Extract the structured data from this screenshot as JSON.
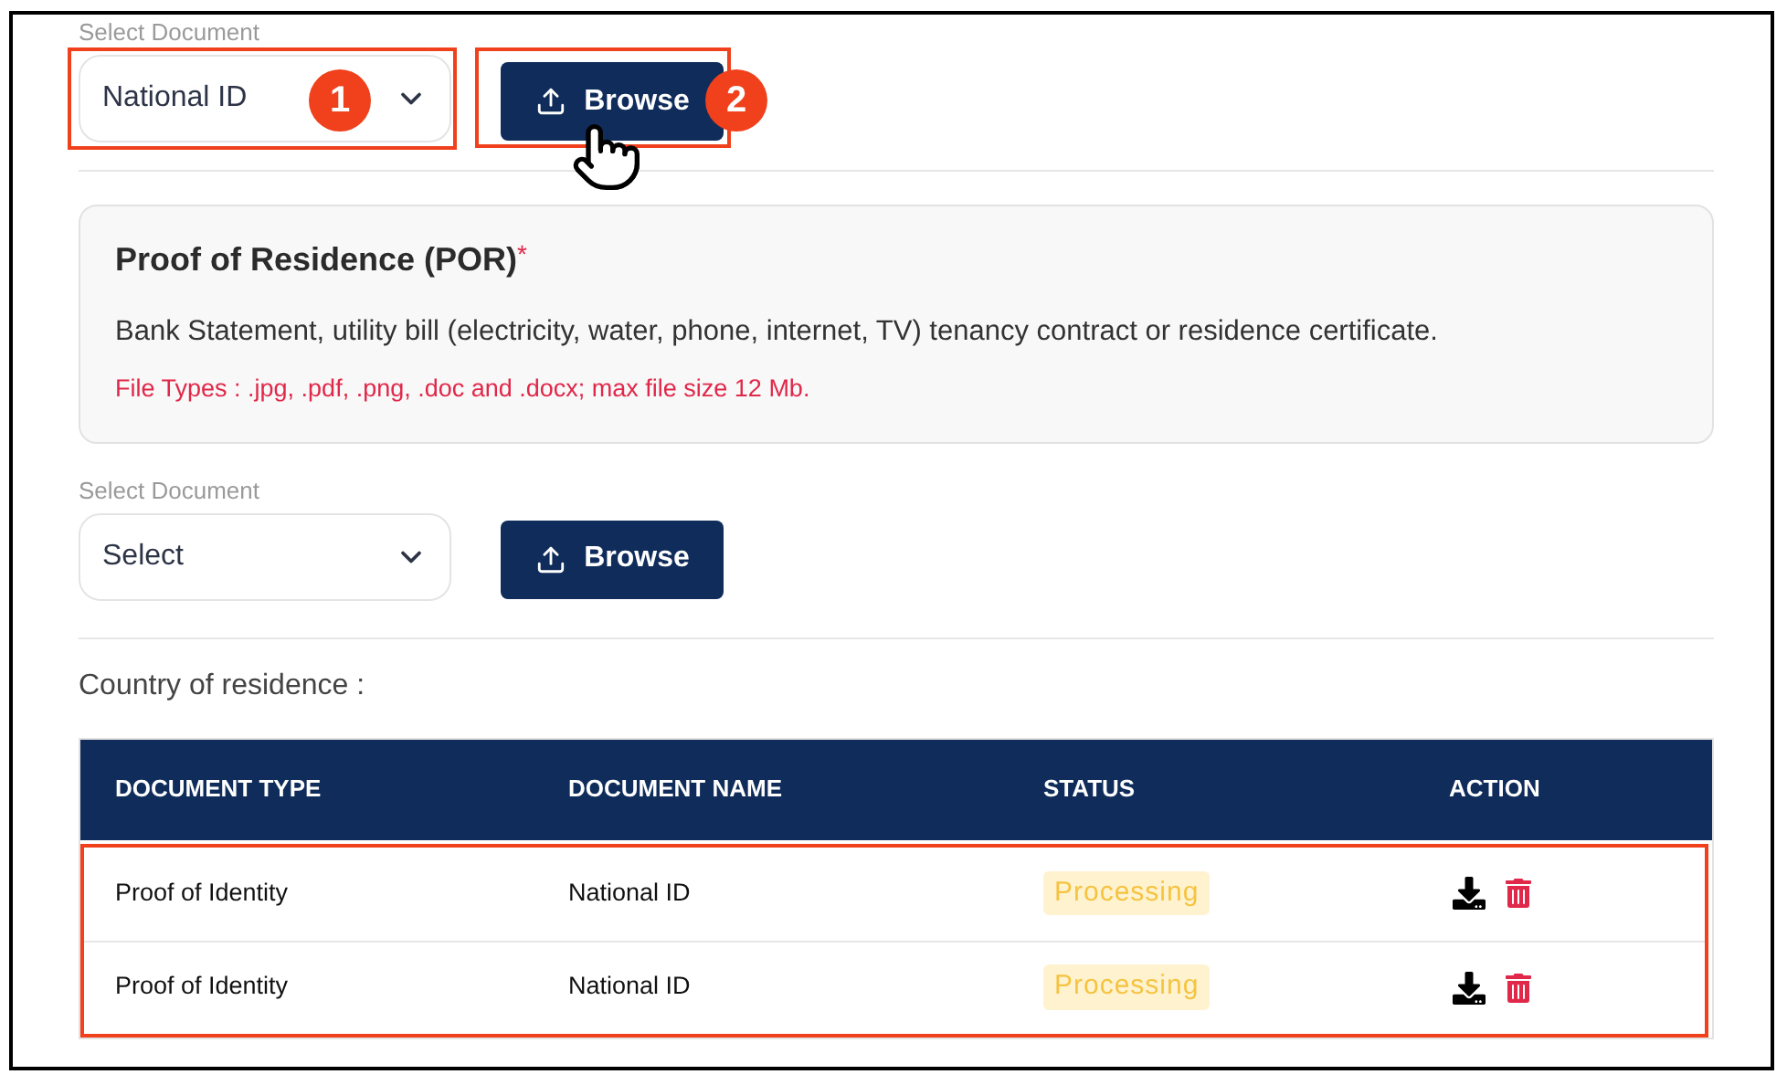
{
  "upload_primary": {
    "label": "Select Document",
    "value": "National ID",
    "highlighted": true,
    "callout": "1",
    "button": "Browse",
    "button_highlighted": true,
    "button_callout": "2",
    "pointer": true
  },
  "card": {
    "title": "Proof of Residence (POR)",
    "required_mark": "*",
    "description": "Bank Statement, utility bill (electricity, water, phone, internet, TV) tenancy contract or residence certificate.",
    "file_types": "File Types : .jpg, .pdf, .png, .doc and .docx; max file size 12 Mb."
  },
  "upload_secondary": {
    "label": "Select Document",
    "value": "Select",
    "highlighted": false,
    "button": "Browse",
    "button_highlighted": false,
    "pointer": false
  },
  "country_label": "Country of residence :",
  "table": {
    "columns": [
      "DOCUMENT TYPE",
      "DOCUMENT NAME",
      "STATUS",
      "ACTION"
    ],
    "rows_highlighted": true,
    "rows": [
      {
        "document_type": "Proof of Identity",
        "document_name": "National ID",
        "status": "Processing"
      },
      {
        "document_type": "Proof of Identity",
        "document_name": "National ID",
        "status": "Processing"
      }
    ]
  }
}
